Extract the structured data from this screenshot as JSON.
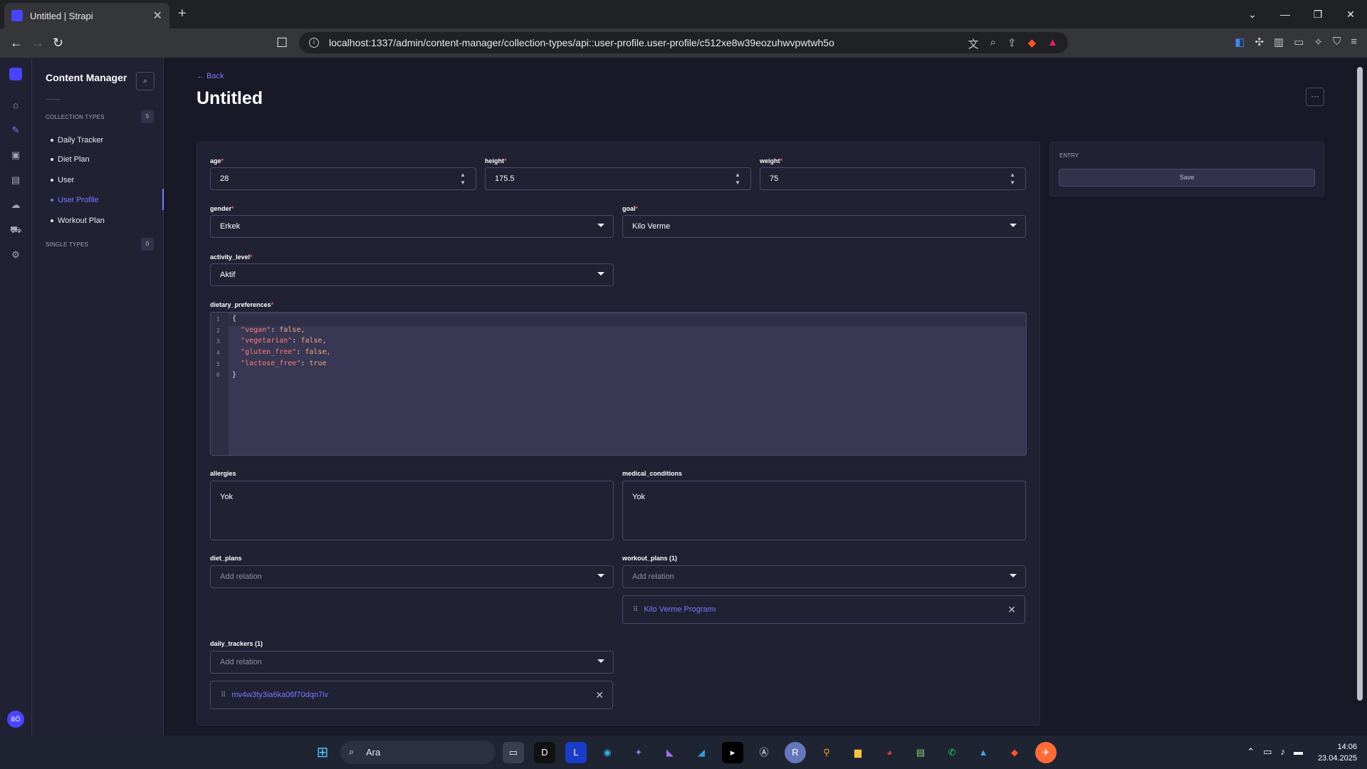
{
  "browser": {
    "tab_title": "Untitled | Strapi",
    "url": "localhost:1337/admin/content-manager/collection-types/api::user-profile.user-profile/c512xe8w39eozuhwvpwtwh5o"
  },
  "sidebar": {
    "title": "Content Manager",
    "collection_types_label": "COLLECTION TYPES",
    "collection_types_count": "5",
    "items": [
      {
        "label": "Daily Tracker"
      },
      {
        "label": "Diet Plan"
      },
      {
        "label": "User"
      },
      {
        "label": "User Profile"
      },
      {
        "label": "Workout Plan"
      }
    ],
    "single_types_label": "SINGLE TYPES",
    "single_types_count": "0",
    "user_initials": "BÖ"
  },
  "header": {
    "back_label": "Back",
    "title": "Untitled",
    "more_label": "···"
  },
  "entry_panel": {
    "label": "ENTRY",
    "save_label": "Save"
  },
  "fields": {
    "age": {
      "label": "age",
      "value": "28"
    },
    "height": {
      "label": "height",
      "value": "175.5"
    },
    "weight": {
      "label": "weight",
      "value": "75"
    },
    "gender": {
      "label": "gender",
      "value": "Erkek"
    },
    "goal": {
      "label": "goal",
      "value": "Kilo Verme"
    },
    "activity_level": {
      "label": "activity_level",
      "value": "Aktif"
    },
    "dietary_preferences": {
      "label": "dietary_preferences"
    },
    "allergies": {
      "label": "allergies",
      "value": "Yok"
    },
    "medical_conditions": {
      "label": "medical_conditions",
      "value": "Yok"
    },
    "diet_plans": {
      "label": "diet_plans",
      "placeholder": "Add relation"
    },
    "workout_plans": {
      "label": "workout_plans (1)",
      "placeholder": "Add relation",
      "relation": "Kilo Verme Programı"
    },
    "daily_trackers": {
      "label": "daily_trackers (1)",
      "placeholder": "Add relation",
      "relation": "mv4w3ty3ia6ka06f70dqn7iv"
    }
  },
  "json_editor": {
    "line_numbers": [
      "1",
      "2",
      "3",
      "4",
      "5",
      "6"
    ],
    "open_brace": "{",
    "close_brace": "}",
    "entries": [
      {
        "key": "\"vegan\"",
        "value": "false,"
      },
      {
        "key": "\"vegetarian\"",
        "value": "false,"
      },
      {
        "key": "\"gluten_free\"",
        "value": "false,"
      },
      {
        "key": "\"lactose_free\"",
        "value": "true"
      }
    ]
  },
  "taskbar": {
    "search_label": "Ara",
    "time": "14:06",
    "date": "23.04.2025"
  },
  "colors": {
    "accent": "#7b79ff",
    "required": "#ee5e52",
    "background": "#181826",
    "panel": "#212134"
  }
}
